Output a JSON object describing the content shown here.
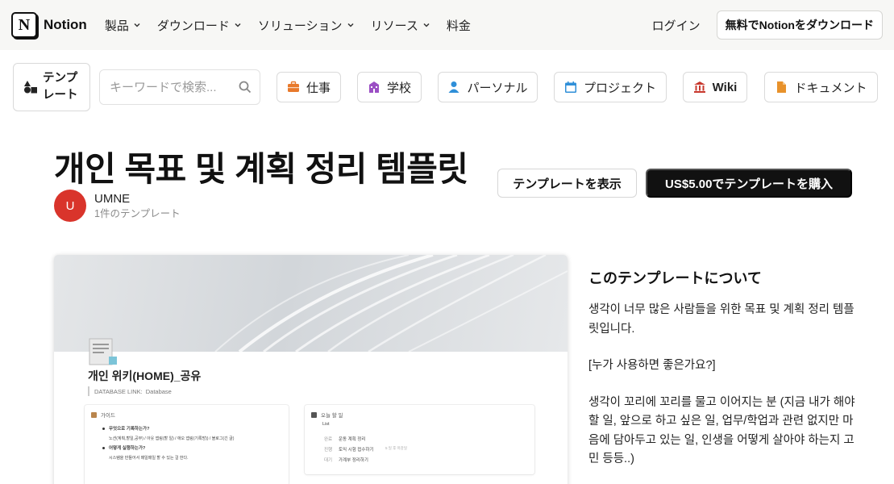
{
  "nav": {
    "brand": "Notion",
    "menu": [
      {
        "label": "製品"
      },
      {
        "label": "ダウンロード"
      },
      {
        "label": "ソリューション"
      },
      {
        "label": "リソース"
      },
      {
        "label": "料金"
      }
    ],
    "login": "ログイン",
    "download_cta": "無料でNotionをダウンロード"
  },
  "catbar": {
    "templates_label": "テンプレート",
    "search_placeholder": "キーワードで検索...",
    "categories": [
      {
        "label": "仕事",
        "icon": "briefcase-icon",
        "color": "#e8792b"
      },
      {
        "label": "学校",
        "icon": "school-icon",
        "color": "#9b4fc4"
      },
      {
        "label": "パーソナル",
        "icon": "person-icon",
        "color": "#2f8fd8"
      },
      {
        "label": "プロジェクト",
        "icon": "calendar-icon",
        "color": "#2f8fd8"
      },
      {
        "label": "Wiki",
        "icon": "building-icon",
        "color": "#c8392e"
      },
      {
        "label": "ドキュメント",
        "icon": "document-icon",
        "color": "#e8922b"
      }
    ]
  },
  "template": {
    "title": "개인 목표 및 계획 정리 템플릿",
    "author": {
      "initial": "U",
      "name": "UMNE",
      "count": "1件のテンプレート",
      "color": "#d9342b"
    },
    "view_button": "テンプレートを表示",
    "buy_button": "US$5.00でテンプレートを購入"
  },
  "preview": {
    "page_title": "개인 위키(HOME)_공유",
    "db_link_label": "DATABASE LINK:",
    "db_link_value": "Database",
    "guide": {
      "heading": "가이드",
      "q1": "무엇으로 기록하는가?",
      "a1": "노션(계획,할일,공부) / 아웃 앱링(할 일) / 애오 앱링(기록방)) / 블로그(긴 글)",
      "q2": "어떻게 실행하는가?",
      "a2": "시스템을 만들어서 매일매일 할 수 있는 걸 한다."
    },
    "today": {
      "heading": "오늘 할 일",
      "view": "List",
      "items": [
        {
          "tag": "완료",
          "text": "운동 계획 정리"
        },
        {
          "tag": "진행",
          "text": "토익 시험 접수하기",
          "note": "5 일 후 마감일"
        },
        {
          "tag": "대기",
          "text": "가계부 정리하기"
        }
      ]
    }
  },
  "about": {
    "heading": "このテンプレートについて",
    "p1": "생각이 너무 많은 사람들을 위한 목표 및 계획 정리 템플릿입니다.",
    "p2": "[누가 사용하면 좋은가요?]",
    "p3": "생각이 꼬리에 꼬리를 물고 이어지는 분 (지금 내가 해야 할 일, 앞으로 하고 싶은 일, 업무/학업과 관련 없지만 마음에 담아두고 있는 일, 인생을 어떻게 살아야 하는지 고민 등등..)"
  }
}
